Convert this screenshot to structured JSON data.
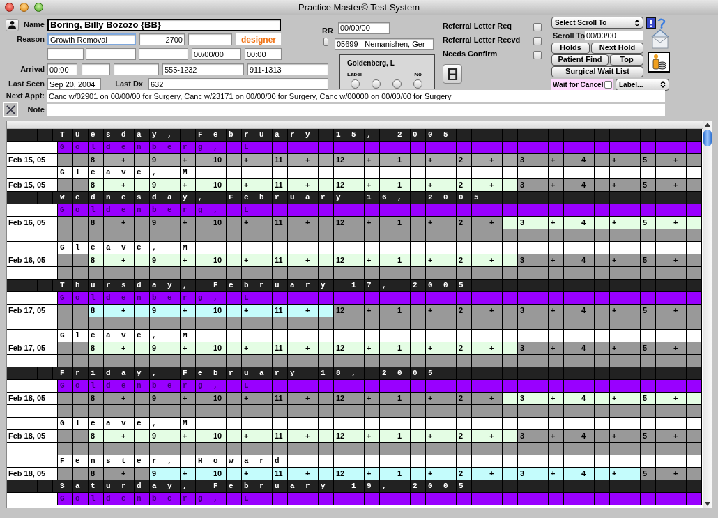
{
  "window": {
    "title": "Practice Master© Test System"
  },
  "patient": {
    "name": {
      "label": "Name",
      "value": "Boring, Billy Bozozo {BB}"
    },
    "reason": {
      "label": "Reason",
      "value": "Growth Removal",
      "code": "2700",
      "tag": "designer"
    },
    "extra": {
      "date": "00/00/00",
      "time": "00:00"
    },
    "arrival": {
      "label": "Arrival",
      "time": "00:00",
      "phone": "555-1232",
      "phone_2": "911-1313"
    },
    "last_seen": {
      "label": "Last Seen",
      "value": "Sep 20, 2004"
    },
    "last_dx": {
      "label": "Last Dx",
      "value": "632"
    },
    "next_appt": {
      "label": "Next Appt:",
      "value": "Canc w/02901 on 00/00/00 for Surgery, Canc w/23171 on 00/00/00 for Surgery, Canc w/00000 on 00/00/00 for Surgery"
    },
    "note": {
      "label": "Note"
    }
  },
  "rr": {
    "label": "RR",
    "checked": false,
    "date": "00/00/00",
    "referrer": "05699 - Nemanishen, Ger"
  },
  "provider_box": {
    "name": "Goldenberg, L",
    "left_label": "Label",
    "right_label": "No",
    "radios": [
      {
        "selected": false
      },
      {
        "selected": false
      },
      {
        "selected": false
      },
      {
        "selected": false
      }
    ]
  },
  "flags": [
    {
      "label": "Referral Letter Req",
      "checked": false
    },
    {
      "label": "Referral Letter Recvd",
      "checked": false
    },
    {
      "label": "Needs Confirm",
      "checked": false
    }
  ],
  "scroll": {
    "select": "Select Scroll To",
    "label": "Scroll To",
    "date": "00/00/00"
  },
  "button_rows": [
    {
      "buttons": [
        "Holds",
        "Next Hold"
      ]
    },
    {
      "buttons": [
        "Patient Find",
        "Top"
      ]
    },
    {
      "buttons": [
        "Surgical Wait List"
      ]
    }
  ],
  "wait_for_cancel": {
    "label": "Wait for Cancel",
    "checked": false
  },
  "label_select": "Label...",
  "schedule": {
    "rows": [
      {
        "kind": "day",
        "text": "T u e s d a y ,   F e b r u a r y   1 5 ,   2 0 0 5"
      },
      {
        "kind": "provider",
        "text": "G o l d e n b e r g ,   L",
        "highlighted": true
      },
      {
        "kind": "time",
        "date": "Feb 15, 05",
        "slots": [
          {
            "color": "#999999"
          },
          {
            "color": "#999999"
          },
          {
            "color": "#aaaaaa",
            "text": "8"
          },
          {
            "color": "#aaaaaa"
          },
          {
            "color": "#aaaaaa",
            "text": "+"
          },
          {
            "color": "#aaaaaa"
          },
          {
            "color": "#aaaaaa",
            "text": "9"
          },
          {
            "color": "#aaaaaa"
          },
          {
            "color": "#aaaaaa",
            "text": "+"
          },
          {
            "color": "#aaaaaa"
          },
          {
            "color": "#aaaaaa",
            "text": "10"
          },
          {
            "color": "#aaaaaa"
          },
          {
            "color": "#aaaaaa",
            "text": "+"
          },
          {
            "color": "#aaaaaa"
          },
          {
            "color": "#aaaaaa",
            "text": "11"
          },
          {
            "color": "#aaaaaa"
          },
          {
            "color": "#aaaaaa",
            "text": "+"
          },
          {
            "color": "#aaaaaa"
          },
          {
            "color": "#aaaaaa",
            "text": "12"
          },
          {
            "color": "#aaaaaa"
          },
          {
            "color": "#aaaaaa",
            "text": "+"
          },
          {
            "color": "#aaaaaa"
          },
          {
            "color": "#aaaaaa",
            "text": "1"
          },
          {
            "color": "#aaaaaa"
          },
          {
            "color": "#aaaaaa",
            "text": "+"
          },
          {
            "color": "#aaaaaa"
          },
          {
            "color": "#aaaaaa",
            "text": "2"
          },
          {
            "color": "#aaaaaa"
          },
          {
            "color": "#aaaaaa",
            "text": "+"
          },
          {
            "color": "#aaaaaa"
          },
          {
            "color": "#999999",
            "text": "3"
          },
          {
            "color": "#999999"
          },
          {
            "color": "#999999",
            "text": "+"
          },
          {
            "color": "#999999"
          },
          {
            "color": "#999999",
            "text": "4"
          },
          {
            "color": "#999999"
          },
          {
            "color": "#999999",
            "text": "+"
          },
          {
            "color": "#999999"
          },
          {
            "color": "#999999",
            "text": "5"
          },
          {
            "color": "#999999"
          },
          {
            "color": "#999999",
            "text": "+"
          },
          {
            "color": "#999999"
          }
        ]
      },
      {
        "kind": "provider",
        "text": "G l e a v e ,   M",
        "highlighted": false
      },
      {
        "kind": "time",
        "date": "Feb 15, 05",
        "slots": [
          {
            "color": "#999999"
          },
          {
            "color": "#999999"
          },
          {
            "color": "#e4fde4",
            "text": "8"
          },
          {
            "color": "#e4fde4"
          },
          {
            "color": "#e4fde4",
            "text": "+"
          },
          {
            "color": "#e4fde4"
          },
          {
            "color": "#e4fde4",
            "text": "9"
          },
          {
            "color": "#e4fde4"
          },
          {
            "color": "#e4fde4",
            "text": "+"
          },
          {
            "color": "#e4fde4"
          },
          {
            "color": "#e4fde4",
            "text": "10"
          },
          {
            "color": "#e4fde4"
          },
          {
            "color": "#e4fde4",
            "text": "+"
          },
          {
            "color": "#e4fde4"
          },
          {
            "color": "#e4fde4",
            "text": "11"
          },
          {
            "color": "#e4fde4"
          },
          {
            "color": "#e4fde4",
            "text": "+"
          },
          {
            "color": "#e4fde4"
          },
          {
            "color": "#e4fde4",
            "text": "12"
          },
          {
            "color": "#e4fde4"
          },
          {
            "color": "#e4fde4",
            "text": "+"
          },
          {
            "color": "#e4fde4"
          },
          {
            "color": "#e4fde4",
            "text": "1"
          },
          {
            "color": "#e4fde4"
          },
          {
            "color": "#e4fde4",
            "text": "+"
          },
          {
            "color": "#e4fde4"
          },
          {
            "color": "#e4fde4",
            "text": "2"
          },
          {
            "color": "#e4fde4"
          },
          {
            "color": "#e4fde4",
            "text": "+"
          },
          {
            "color": "#e4fde4"
          },
          {
            "color": "#999999",
            "text": "3"
          },
          {
            "color": "#999999"
          },
          {
            "color": "#999999",
            "text": "+"
          },
          {
            "color": "#999999"
          },
          {
            "color": "#999999",
            "text": "4"
          },
          {
            "color": "#999999"
          },
          {
            "color": "#999999",
            "text": "+"
          },
          {
            "color": "#999999"
          },
          {
            "color": "#999999",
            "text": "5"
          },
          {
            "color": "#999999"
          },
          {
            "color": "#999999",
            "text": "+"
          },
          {
            "color": "#999999"
          }
        ]
      },
      {
        "kind": "day",
        "text": "W e d n e s d a y ,   F e b r u a r y   1 6 ,   2 0 0 5"
      },
      {
        "kind": "provider",
        "text": "G o l d e n b e r g ,   L",
        "highlighted": true
      },
      {
        "kind": "time",
        "date": "Feb 16, 05",
        "slots": [
          {
            "color": "#999999"
          },
          {
            "color": "#999999"
          },
          {
            "color": "#999999",
            "text": "8"
          },
          {
            "color": "#999999"
          },
          {
            "color": "#999999",
            "text": "+"
          },
          {
            "color": "#999999"
          },
          {
            "color": "#999999",
            "text": "9"
          },
          {
            "color": "#999999"
          },
          {
            "color": "#999999",
            "text": "+"
          },
          {
            "color": "#999999"
          },
          {
            "color": "#999999",
            "text": "10"
          },
          {
            "color": "#999999"
          },
          {
            "color": "#999999",
            "text": "+"
          },
          {
            "color": "#999999"
          },
          {
            "color": "#999999",
            "text": "11"
          },
          {
            "color": "#999999"
          },
          {
            "color": "#999999",
            "text": "+"
          },
          {
            "color": "#999999"
          },
          {
            "color": "#999999",
            "text": "12"
          },
          {
            "color": "#999999"
          },
          {
            "color": "#999999",
            "text": "+"
          },
          {
            "color": "#999999"
          },
          {
            "color": "#999999",
            "text": "1"
          },
          {
            "color": "#999999"
          },
          {
            "color": "#999999",
            "text": "+"
          },
          {
            "color": "#999999"
          },
          {
            "color": "#999999",
            "text": "2"
          },
          {
            "color": "#999999"
          },
          {
            "color": "#999999",
            "text": "+"
          },
          {
            "color": "#e4fde4"
          },
          {
            "color": "#e4fde4",
            "text": "3"
          },
          {
            "color": "#e4fde4"
          },
          {
            "color": "#e4fde4",
            "text": "+"
          },
          {
            "color": "#e4fde4"
          },
          {
            "color": "#e4fde4",
            "text": "4"
          },
          {
            "color": "#e4fde4"
          },
          {
            "color": "#e4fde4",
            "text": "+"
          },
          {
            "color": "#e4fde4"
          },
          {
            "color": "#e4fde4",
            "text": "5"
          },
          {
            "color": "#e4fde4"
          },
          {
            "color": "#e4fde4",
            "text": "+"
          },
          {
            "color": "#e4fde4"
          }
        ]
      },
      {
        "kind": "blank"
      },
      {
        "kind": "provider",
        "text": "G l e a v e ,   M",
        "highlighted": false
      },
      {
        "kind": "time",
        "date": "Feb 16, 05",
        "slots": [
          {
            "color": "#999999"
          },
          {
            "color": "#999999"
          },
          {
            "color": "#e4fde4",
            "text": "8"
          },
          {
            "color": "#e4fde4"
          },
          {
            "color": "#e4fde4",
            "text": "+"
          },
          {
            "color": "#e4fde4"
          },
          {
            "color": "#e4fde4",
            "text": "9"
          },
          {
            "color": "#e4fde4"
          },
          {
            "color": "#e4fde4",
            "text": "+"
          },
          {
            "color": "#e4fde4"
          },
          {
            "color": "#e4fde4",
            "text": "10"
          },
          {
            "color": "#e4fde4"
          },
          {
            "color": "#e4fde4",
            "text": "+"
          },
          {
            "color": "#e4fde4"
          },
          {
            "color": "#e4fde4",
            "text": "11"
          },
          {
            "color": "#e4fde4"
          },
          {
            "color": "#e4fde4",
            "text": "+"
          },
          {
            "color": "#e4fde4"
          },
          {
            "color": "#e4fde4",
            "text": "12"
          },
          {
            "color": "#e4fde4"
          },
          {
            "color": "#e4fde4",
            "text": "+"
          },
          {
            "color": "#e4fde4"
          },
          {
            "color": "#e4fde4",
            "text": "1"
          },
          {
            "color": "#e4fde4"
          },
          {
            "color": "#e4fde4",
            "text": "+"
          },
          {
            "color": "#e4fde4"
          },
          {
            "color": "#e4fde4",
            "text": "2"
          },
          {
            "color": "#e4fde4"
          },
          {
            "color": "#e4fde4",
            "text": "+"
          },
          {
            "color": "#e4fde4"
          },
          {
            "color": "#999999",
            "text": "3"
          },
          {
            "color": "#999999"
          },
          {
            "color": "#999999",
            "text": "+"
          },
          {
            "color": "#999999"
          },
          {
            "color": "#999999",
            "text": "4"
          },
          {
            "color": "#999999"
          },
          {
            "color": "#999999",
            "text": "+"
          },
          {
            "color": "#999999"
          },
          {
            "color": "#999999",
            "text": "5"
          },
          {
            "color": "#999999"
          },
          {
            "color": "#999999",
            "text": "+"
          },
          {
            "color": "#999999"
          }
        ]
      },
      {
        "kind": "blank"
      },
      {
        "kind": "day",
        "text": "T h u r s d a y ,   F e b r u a r y   1 7 ,   2 0 0 5"
      },
      {
        "kind": "provider",
        "text": "G o l d e n b e r g ,   L",
        "highlighted": true
      },
      {
        "kind": "time",
        "date": "Feb 17, 05",
        "slots": [
          {
            "color": "#999999"
          },
          {
            "color": "#999999"
          },
          {
            "color": "#c4fcfc",
            "text": "8"
          },
          {
            "color": "#c4fcfc"
          },
          {
            "color": "#c4fcfc",
            "text": "+"
          },
          {
            "color": "#c4fcfc"
          },
          {
            "color": "#c4fcfc",
            "text": "9"
          },
          {
            "color": "#c4fcfc"
          },
          {
            "color": "#c4fcfc",
            "text": "+"
          },
          {
            "color": "#c4fcfc"
          },
          {
            "color": "#c4fcfc",
            "text": "10"
          },
          {
            "color": "#c4fcfc"
          },
          {
            "color": "#c4fcfc",
            "text": "+"
          },
          {
            "color": "#c4fcfc"
          },
          {
            "color": "#c4fcfc",
            "text": "11"
          },
          {
            "color": "#c4fcfc"
          },
          {
            "color": "#c4fcfc",
            "text": "+"
          },
          {
            "color": "#c4fcfc"
          },
          {
            "color": "#999999",
            "text": "12"
          },
          {
            "color": "#999999"
          },
          {
            "color": "#999999",
            "text": "+"
          },
          {
            "color": "#999999"
          },
          {
            "color": "#999999",
            "text": "1"
          },
          {
            "color": "#999999"
          },
          {
            "color": "#999999",
            "text": "+"
          },
          {
            "color": "#999999"
          },
          {
            "color": "#999999",
            "text": "2"
          },
          {
            "color": "#999999"
          },
          {
            "color": "#999999",
            "text": "+"
          },
          {
            "color": "#999999"
          },
          {
            "color": "#999999",
            "text": "3"
          },
          {
            "color": "#999999"
          },
          {
            "color": "#999999",
            "text": "+"
          },
          {
            "color": "#999999"
          },
          {
            "color": "#999999",
            "text": "4"
          },
          {
            "color": "#999999"
          },
          {
            "color": "#999999",
            "text": "+"
          },
          {
            "color": "#999999"
          },
          {
            "color": "#999999",
            "text": "5"
          },
          {
            "color": "#999999"
          },
          {
            "color": "#999999",
            "text": "+"
          },
          {
            "color": "#999999"
          }
        ]
      },
      {
        "kind": "blank"
      },
      {
        "kind": "provider",
        "text": "G l e a v e ,   M",
        "highlighted": false
      },
      {
        "kind": "time",
        "date": "Feb 17, 05",
        "slots": [
          {
            "color": "#999999"
          },
          {
            "color": "#999999"
          },
          {
            "color": "#e4fde4",
            "text": "8"
          },
          {
            "color": "#e4fde4"
          },
          {
            "color": "#e4fde4",
            "text": "+"
          },
          {
            "color": "#e4fde4"
          },
          {
            "color": "#e4fde4",
            "text": "9"
          },
          {
            "color": "#e4fde4"
          },
          {
            "color": "#e4fde4",
            "text": "+"
          },
          {
            "color": "#e4fde4"
          },
          {
            "color": "#e4fde4",
            "text": "10"
          },
          {
            "color": "#e4fde4"
          },
          {
            "color": "#e4fde4",
            "text": "+"
          },
          {
            "color": "#e4fde4"
          },
          {
            "color": "#e4fde4",
            "text": "11"
          },
          {
            "color": "#e4fde4"
          },
          {
            "color": "#e4fde4",
            "text": "+"
          },
          {
            "color": "#e4fde4"
          },
          {
            "color": "#e4fde4",
            "text": "12"
          },
          {
            "color": "#e4fde4"
          },
          {
            "color": "#e4fde4",
            "text": "+"
          },
          {
            "color": "#e4fde4"
          },
          {
            "color": "#e4fde4",
            "text": "1"
          },
          {
            "color": "#e4fde4"
          },
          {
            "color": "#e4fde4",
            "text": "+"
          },
          {
            "color": "#e4fde4"
          },
          {
            "color": "#e4fde4",
            "text": "2"
          },
          {
            "color": "#e4fde4"
          },
          {
            "color": "#e4fde4",
            "text": "+"
          },
          {
            "color": "#e4fde4"
          },
          {
            "color": "#999999",
            "text": "3"
          },
          {
            "color": "#999999"
          },
          {
            "color": "#999999",
            "text": "+"
          },
          {
            "color": "#999999"
          },
          {
            "color": "#999999",
            "text": "4"
          },
          {
            "color": "#999999"
          },
          {
            "color": "#999999",
            "text": "+"
          },
          {
            "color": "#999999"
          },
          {
            "color": "#999999",
            "text": "5"
          },
          {
            "color": "#999999"
          },
          {
            "color": "#999999",
            "text": "+"
          },
          {
            "color": "#999999"
          }
        ]
      },
      {
        "kind": "blank"
      },
      {
        "kind": "day",
        "text": "F r i d a y ,   F e b r u a r y   1 8 ,   2 0 0 5"
      },
      {
        "kind": "provider",
        "text": "G o l d e n b e r g ,   L",
        "highlighted": true
      },
      {
        "kind": "time",
        "date": "Feb 18, 05",
        "slots": [
          {
            "color": "#999999"
          },
          {
            "color": "#999999"
          },
          {
            "color": "#999999",
            "text": "8"
          },
          {
            "color": "#999999"
          },
          {
            "color": "#999999",
            "text": "+"
          },
          {
            "color": "#999999"
          },
          {
            "color": "#999999",
            "text": "9"
          },
          {
            "color": "#999999"
          },
          {
            "color": "#999999",
            "text": "+"
          },
          {
            "color": "#999999"
          },
          {
            "color": "#999999",
            "text": "10"
          },
          {
            "color": "#999999"
          },
          {
            "color": "#999999",
            "text": "+"
          },
          {
            "color": "#999999"
          },
          {
            "color": "#999999",
            "text": "11"
          },
          {
            "color": "#999999"
          },
          {
            "color": "#999999",
            "text": "+"
          },
          {
            "color": "#999999"
          },
          {
            "color": "#999999",
            "text": "12"
          },
          {
            "color": "#999999"
          },
          {
            "color": "#999999",
            "text": "+"
          },
          {
            "color": "#999999"
          },
          {
            "color": "#999999",
            "text": "1"
          },
          {
            "color": "#999999"
          },
          {
            "color": "#999999",
            "text": "+"
          },
          {
            "color": "#999999"
          },
          {
            "color": "#999999",
            "text": "2"
          },
          {
            "color": "#999999"
          },
          {
            "color": "#999999",
            "text": "+"
          },
          {
            "color": "#e4fde4"
          },
          {
            "color": "#e4fde4",
            "text": "3"
          },
          {
            "color": "#e4fde4"
          },
          {
            "color": "#e4fde4",
            "text": "+"
          },
          {
            "color": "#e4fde4"
          },
          {
            "color": "#e4fde4",
            "text": "4"
          },
          {
            "color": "#e4fde4"
          },
          {
            "color": "#e4fde4",
            "text": "+"
          },
          {
            "color": "#e4fde4"
          },
          {
            "color": "#e4fde4",
            "text": "5"
          },
          {
            "color": "#e4fde4"
          },
          {
            "color": "#e4fde4",
            "text": "+"
          },
          {
            "color": "#e4fde4"
          }
        ]
      },
      {
        "kind": "blank"
      },
      {
        "kind": "provider",
        "text": "G l e a v e ,   M",
        "highlighted": false
      },
      {
        "kind": "time",
        "date": "Feb 18, 05",
        "slots": [
          {
            "color": "#999999"
          },
          {
            "color": "#999999"
          },
          {
            "color": "#e4fde4",
            "text": "8"
          },
          {
            "color": "#e4fde4"
          },
          {
            "color": "#e4fde4",
            "text": "+"
          },
          {
            "color": "#e4fde4"
          },
          {
            "color": "#e4fde4",
            "text": "9"
          },
          {
            "color": "#e4fde4"
          },
          {
            "color": "#e4fde4",
            "text": "+"
          },
          {
            "color": "#e4fde4"
          },
          {
            "color": "#e4fde4",
            "text": "10"
          },
          {
            "color": "#e4fde4"
          },
          {
            "color": "#e4fde4",
            "text": "+"
          },
          {
            "color": "#e4fde4"
          },
          {
            "color": "#e4fde4",
            "text": "11"
          },
          {
            "color": "#e4fde4"
          },
          {
            "color": "#e4fde4",
            "text": "+"
          },
          {
            "color": "#e4fde4"
          },
          {
            "color": "#e4fde4",
            "text": "12"
          },
          {
            "color": "#e4fde4"
          },
          {
            "color": "#e4fde4",
            "text": "+"
          },
          {
            "color": "#e4fde4"
          },
          {
            "color": "#e4fde4",
            "text": "1"
          },
          {
            "color": "#e4fde4"
          },
          {
            "color": "#e4fde4",
            "text": "+"
          },
          {
            "color": "#e4fde4"
          },
          {
            "color": "#e4fde4",
            "text": "2"
          },
          {
            "color": "#e4fde4"
          },
          {
            "color": "#e4fde4",
            "text": "+"
          },
          {
            "color": "#e4fde4"
          },
          {
            "color": "#999999",
            "text": "3"
          },
          {
            "color": "#999999"
          },
          {
            "color": "#999999",
            "text": "+"
          },
          {
            "color": "#999999"
          },
          {
            "color": "#999999",
            "text": "4"
          },
          {
            "color": "#999999"
          },
          {
            "color": "#999999",
            "text": "+"
          },
          {
            "color": "#999999"
          },
          {
            "color": "#999999",
            "text": "5"
          },
          {
            "color": "#999999"
          },
          {
            "color": "#999999",
            "text": "+"
          },
          {
            "color": "#999999"
          }
        ]
      },
      {
        "kind": "blank"
      },
      {
        "kind": "provider",
        "text": "F e n s t e r ,   H o w a r d",
        "highlighted": false
      },
      {
        "kind": "time",
        "date": "Feb 18, 05",
        "slots": [
          {
            "color": "#999999"
          },
          {
            "color": "#999999"
          },
          {
            "color": "#999999",
            "text": "8"
          },
          {
            "color": "#999999"
          },
          {
            "color": "#999999",
            "text": "+"
          },
          {
            "color": "#999999"
          },
          {
            "color": "#c4fcfc",
            "text": "9"
          },
          {
            "color": "#c4fcfc"
          },
          {
            "color": "#c4fcfc",
            "text": "+"
          },
          {
            "color": "#c4fcfc"
          },
          {
            "color": "#c4fcfc",
            "text": "10"
          },
          {
            "color": "#c4fcfc"
          },
          {
            "color": "#c4fcfc",
            "text": "+"
          },
          {
            "color": "#c4fcfc"
          },
          {
            "color": "#c4fcfc",
            "text": "11"
          },
          {
            "color": "#c4fcfc"
          },
          {
            "color": "#c4fcfc",
            "text": "+"
          },
          {
            "color": "#c4fcfc"
          },
          {
            "color": "#c4fcfc",
            "text": "12"
          },
          {
            "color": "#c4fcfc"
          },
          {
            "color": "#c4fcfc",
            "text": "+"
          },
          {
            "color": "#c4fcfc"
          },
          {
            "color": "#c4fcfc",
            "text": "1"
          },
          {
            "color": "#c4fcfc"
          },
          {
            "color": "#c4fcfc",
            "text": "+"
          },
          {
            "color": "#c4fcfc"
          },
          {
            "color": "#c4fcfc",
            "text": "2"
          },
          {
            "color": "#c4fcfc"
          },
          {
            "color": "#c4fcfc",
            "text": "+"
          },
          {
            "color": "#c4fcfc"
          },
          {
            "color": "#c4fcfc",
            "text": "3"
          },
          {
            "color": "#c4fcfc"
          },
          {
            "color": "#c4fcfc",
            "text": "+"
          },
          {
            "color": "#c4fcfc"
          },
          {
            "color": "#c4fcfc",
            "text": "4"
          },
          {
            "color": "#c4fcfc"
          },
          {
            "color": "#c4fcfc",
            "text": "+"
          },
          {
            "color": "#c4fcfc"
          },
          {
            "color": "#999999",
            "text": "5"
          },
          {
            "color": "#999999"
          },
          {
            "color": "#999999",
            "text": "+"
          },
          {
            "color": "#999999"
          }
        ]
      },
      {
        "kind": "day",
        "text": "S a t u r d a y ,   F e b r u a r y   1 9 ,   2 0 0 5"
      },
      {
        "kind": "provider",
        "text": "G o l d e n b e r g ,   L",
        "highlighted": true
      }
    ]
  }
}
